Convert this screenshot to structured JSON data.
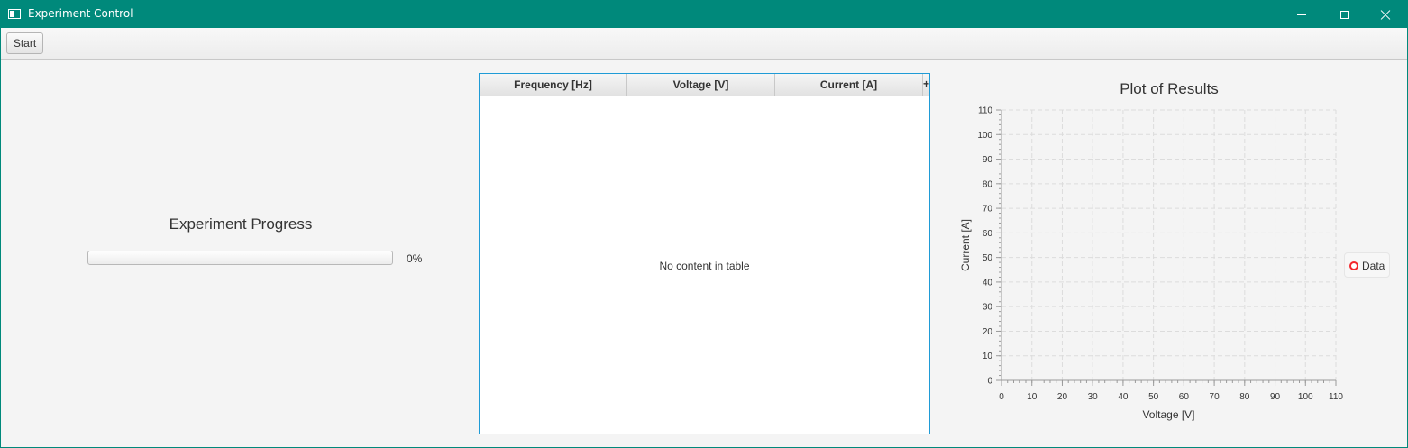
{
  "window": {
    "title": "Experiment Control"
  },
  "toolbar": {
    "start_label": "Start"
  },
  "progress": {
    "title": "Experiment Progress",
    "value_percent": 0,
    "label": "0%",
    "fill_color": "#2196f3"
  },
  "table": {
    "columns": [
      "Frequency [Hz]",
      "Voltage [V]",
      "Current [A]"
    ],
    "menu_button": "+",
    "empty_text": "No content in table"
  },
  "chart_data": {
    "type": "scatter",
    "title": "Plot of Results",
    "xlabel": "Voltage [V]",
    "ylabel": "Current [A]",
    "xlim": [
      0,
      110
    ],
    "ylim": [
      0,
      110
    ],
    "x_ticks": [
      0,
      10,
      20,
      30,
      40,
      50,
      60,
      70,
      80,
      90,
      100,
      110
    ],
    "y_ticks": [
      0,
      10,
      20,
      30,
      40,
      50,
      60,
      70,
      80,
      90,
      100,
      110
    ],
    "grid": true,
    "series": [
      {
        "name": "Data",
        "color": "#f3262b",
        "x": [],
        "y": []
      }
    ],
    "legend_position": "right"
  }
}
